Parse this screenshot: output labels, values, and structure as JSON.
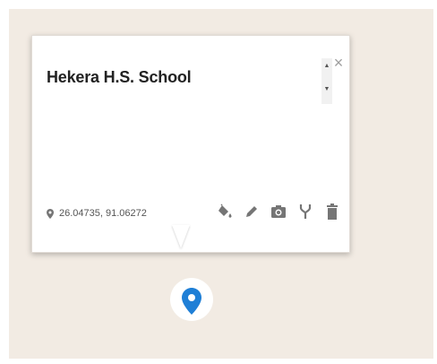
{
  "place": {
    "title": "Hekera H.S. School",
    "coordinates": "26.04735, 91.06272"
  },
  "popup": {
    "close_label": "×"
  },
  "scrollbar": {
    "up_arrow": "▲",
    "down_arrow": "▼"
  },
  "icons": {
    "location": "map-pin-icon",
    "style": "paint-bucket-icon",
    "edit": "pencil-icon",
    "photo": "camera-icon",
    "directions": "route-fork-icon",
    "delete": "trash-icon",
    "marker": "map-marker-icon"
  },
  "colors": {
    "map_background": "#f2ebe3",
    "marker": "#1f7fd6",
    "icon": "#757575"
  }
}
